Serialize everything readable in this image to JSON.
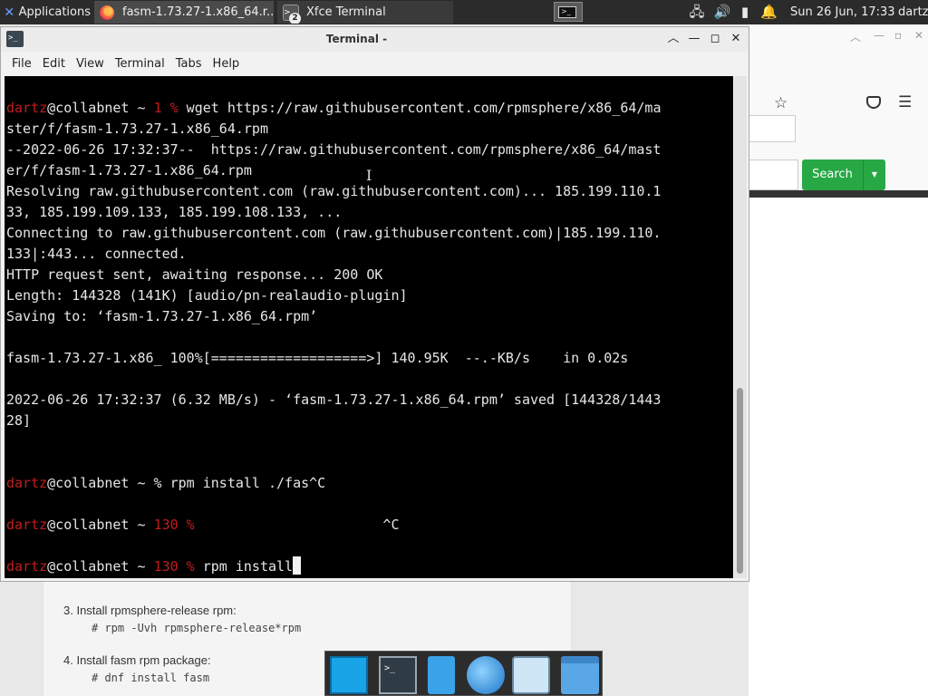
{
  "top_panel": {
    "apps_label": "Applications",
    "tasks": [
      {
        "label": "fasm-1.73.27-1.x86_64.r..."
      },
      {
        "label": "Xfce Terminal",
        "badge": "2"
      }
    ],
    "clock": "Sun 26 Jun, 17:33",
    "user": "dartz"
  },
  "terminal": {
    "title": "Terminal -",
    "menu": [
      "File",
      "Edit",
      "View",
      "Terminal",
      "Tabs",
      "Help"
    ],
    "lines": [
      {
        "segments": [
          {
            "text": "dartz",
            "style": "user"
          },
          {
            "text": "@collabnet ~ "
          },
          {
            "text": "1 %",
            "style": "red"
          },
          {
            "text": " wget https://raw.githubusercontent.com/rpmsphere/x86_64/ma"
          }
        ]
      },
      {
        "segments": [
          {
            "text": "ster/f/fasm-1.73.27-1.x86_64.rpm"
          }
        ]
      },
      {
        "segments": [
          {
            "text": "--2022-06-26 17:32:37--  https://raw.githubusercontent.com/rpmsphere/x86_64/mast"
          }
        ]
      },
      {
        "segments": [
          {
            "text": "er/f/fasm-1.73.27-1.x86_64.rpm"
          }
        ]
      },
      {
        "segments": [
          {
            "text": "Resolving raw.githubusercontent.com (raw.githubusercontent.com)... 185.199.110.1"
          }
        ]
      },
      {
        "segments": [
          {
            "text": "33, 185.199.109.133, 185.199.108.133, ..."
          }
        ]
      },
      {
        "segments": [
          {
            "text": "Connecting to raw.githubusercontent.com (raw.githubusercontent.com)|185.199.110."
          }
        ]
      },
      {
        "segments": [
          {
            "text": "133|:443... connected."
          }
        ]
      },
      {
        "segments": [
          {
            "text": "HTTP request sent, awaiting response... 200 OK"
          }
        ]
      },
      {
        "segments": [
          {
            "text": "Length: 144328 (141K) [audio/pn-realaudio-plugin]"
          }
        ]
      },
      {
        "segments": [
          {
            "text": "Saving to: ‘fasm-1.73.27-1.x86_64.rpm’"
          }
        ]
      },
      {
        "segments": []
      },
      {
        "segments": [
          {
            "text": "fasm-1.73.27-1.x86_ 100%[===================>] 140.95K  --.-KB/s    in 0.02s"
          }
        ]
      },
      {
        "segments": []
      },
      {
        "segments": [
          {
            "text": "2022-06-26 17:32:37 (6.32 MB/s) - ‘fasm-1.73.27-1.x86_64.rpm’ saved [144328/1443"
          }
        ]
      },
      {
        "segments": [
          {
            "text": "28]"
          }
        ]
      },
      {
        "segments": []
      },
      {
        "segments": []
      },
      {
        "segments": [
          {
            "text": "dartz",
            "style": "user"
          },
          {
            "text": "@collabnet ~ % rpm install ./fas^C"
          }
        ]
      },
      {
        "segments": []
      },
      {
        "segments": [
          {
            "text": "dartz",
            "style": "user"
          },
          {
            "text": "@collabnet ~ "
          },
          {
            "text": "130 %",
            "style": "red"
          },
          {
            "text": "                       ^C"
          }
        ]
      },
      {
        "segments": []
      },
      {
        "segments": [
          {
            "text": "dartz",
            "style": "user"
          },
          {
            "text": "@collabnet ~ "
          },
          {
            "text": "130 %",
            "style": "red"
          },
          {
            "text": " rpm install"
          }
        ],
        "cursor": true
      }
    ]
  },
  "browser": {
    "search_button": "Search"
  },
  "page_content": {
    "steps": [
      {
        "label": "3. Install rpmsphere-release rpm:",
        "code": "# rpm -Uvh rpmsphere-release*rpm"
      },
      {
        "label": "4. Install fasm rpm package:",
        "code": "# dnf install fasm"
      }
    ]
  },
  "dock": {
    "items": [
      "desktop-icon",
      "terminal-icon",
      "files-icon",
      "web-browser-icon",
      "app-finder-icon",
      "folder-icon"
    ]
  },
  "colors": {
    "terminal_bg": "#000000",
    "terminal_fg": "#e6e6e6",
    "prompt_user": "#c21d1d",
    "search_button": "#28a745"
  }
}
